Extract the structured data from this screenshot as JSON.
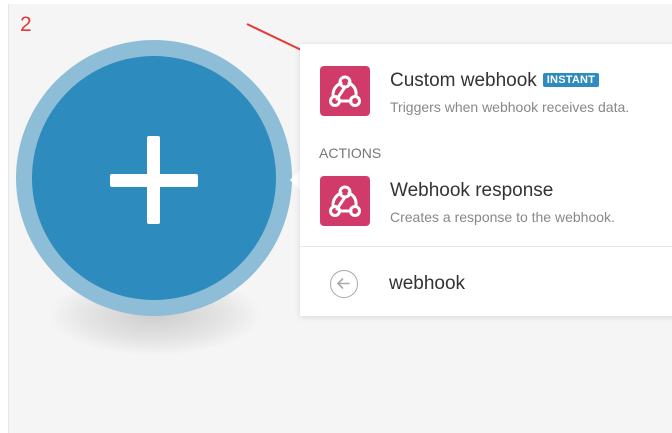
{
  "annotation": {
    "step_number": "2",
    "color": "#e53935"
  },
  "module": {
    "icon": "plus-icon",
    "ring_color": "#8ebdd8",
    "fill_color": "#2e8bbd"
  },
  "popup": {
    "triggers": [
      {
        "title": "Custom webhook",
        "badge": "INSTANT",
        "description": "Triggers when webhook receives data.",
        "icon": "webhook-icon"
      }
    ],
    "actions_label": "ACTIONS",
    "actions": [
      {
        "title": "Webhook response",
        "description": "Creates a response to the webhook.",
        "icon": "webhook-icon"
      }
    ],
    "back_icon": "arrow-left-circle-icon",
    "search_value": "webhook",
    "icon_color": "#d13b6a",
    "badge_color": "#2e8bbd"
  }
}
